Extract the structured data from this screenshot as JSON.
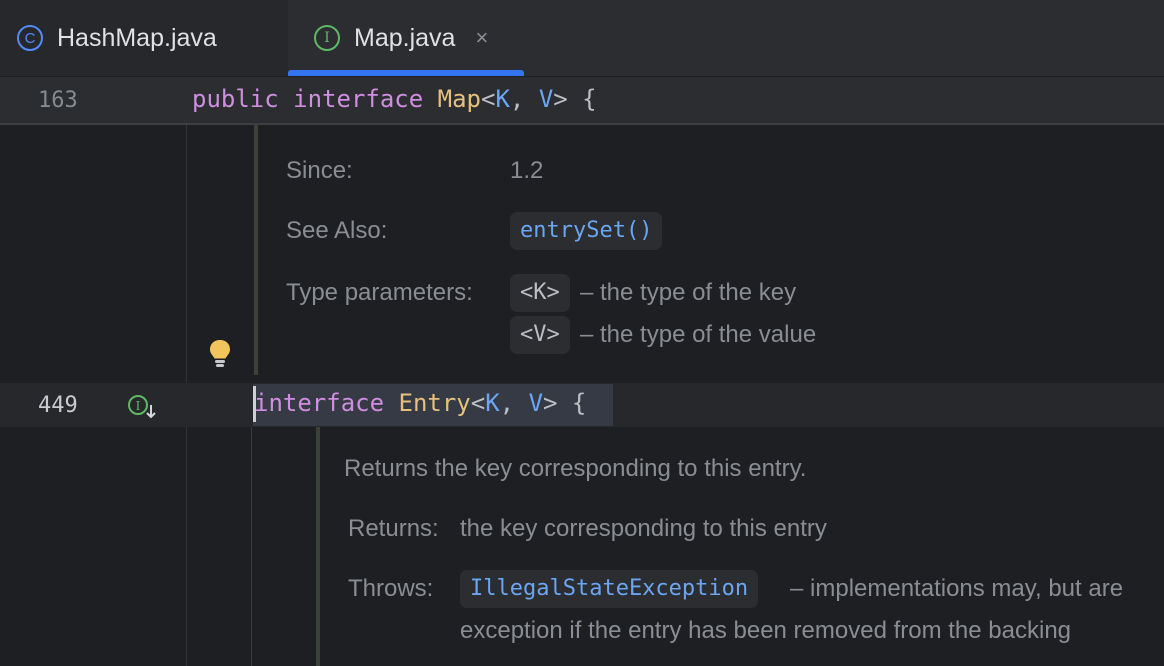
{
  "tabs": [
    {
      "label": "HashMap.java",
      "icon": "class-icon",
      "icon_glyph": "C"
    },
    {
      "label": "Map.java",
      "icon": "interface-icon",
      "icon_glyph": "I",
      "close": "×",
      "active": true
    }
  ],
  "sticky_line": {
    "number": "163",
    "tokens": {
      "public": "public",
      "interface": "interface",
      "name": "Map",
      "open": "<",
      "k": "K",
      "comma": ", ",
      "v": "V",
      "close": ">",
      "brace": " {"
    }
  },
  "doc1": {
    "since_label": "Since:",
    "since_value": "1.2",
    "see_also_label": "See Also:",
    "see_also_link": "entrySet()",
    "type_params_label": "Type parameters:",
    "param_k": "<K>",
    "param_k_desc": "– the type of the key",
    "param_v": "<V>",
    "param_v_desc": "– the type of the value"
  },
  "entry_line": {
    "number": "449",
    "tokens": {
      "interface": "interface",
      "name": "Entry",
      "open": "<",
      "k": "K",
      "comma": ", ",
      "v": "V",
      "close": ">",
      "brace": " {"
    }
  },
  "doc2": {
    "summary": "Returns the key corresponding to this entry.",
    "returns_label": "Returns:",
    "returns_value": "the key corresponding to this entry",
    "throws_label": "Throws:",
    "throws_exception": "IllegalStateException",
    "throws_desc_1": "– implementations may, but are",
    "throws_desc_2": "exception if the entry has been removed from the backing"
  },
  "colors": {
    "background": "#1e1f22",
    "keyword": "#cf8ee0",
    "type": "#e6c17d",
    "type_param": "#6aa6f4",
    "tab_underline": "#3574f0"
  }
}
